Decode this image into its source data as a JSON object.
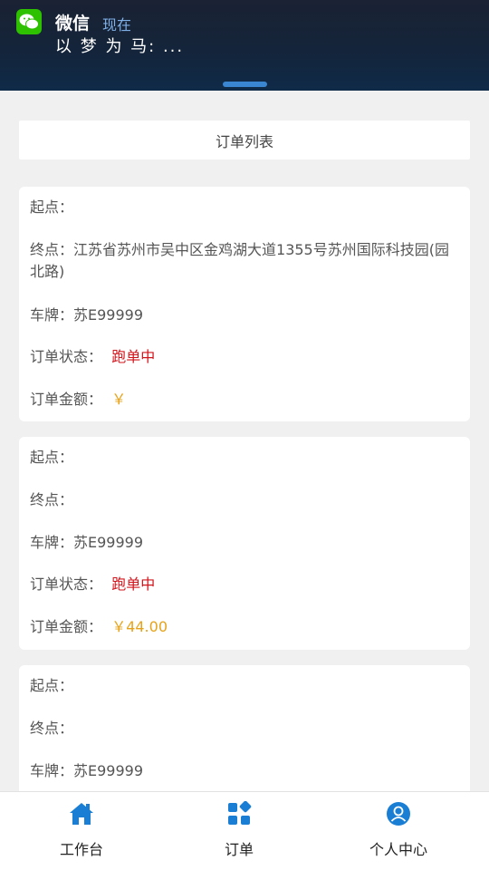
{
  "notification": {
    "app_name": "微信",
    "time": "现在",
    "message": "以 梦 为 马: ..."
  },
  "header": {
    "title": "订单列表"
  },
  "labels": {
    "start": "起点：",
    "end": "终点：",
    "plate": "车牌：",
    "status": "订单状态：",
    "amount": "订单金额："
  },
  "orders": [
    {
      "start": "",
      "end": "江苏省苏州市吴中区金鸡湖大道1355号苏州国际科技园(园北路)",
      "plate": "苏E99999",
      "status": "跑单中",
      "amount": "￥"
    },
    {
      "start": "",
      "end": "",
      "plate": "苏E99999",
      "status": "跑单中",
      "amount": "￥44.00"
    },
    {
      "start": "",
      "end": "",
      "plate": "苏E99999"
    }
  ],
  "tabbar": {
    "items": [
      {
        "label": "工作台",
        "icon": "home-icon"
      },
      {
        "label": "订单",
        "icon": "grid-icon"
      },
      {
        "label": "个人中心",
        "icon": "user-icon"
      }
    ]
  },
  "colors": {
    "accent": "#1a7fd4",
    "status_red": "#d0151c",
    "amount_gold": "#e6a31a",
    "wechat_green": "#2dc100"
  }
}
